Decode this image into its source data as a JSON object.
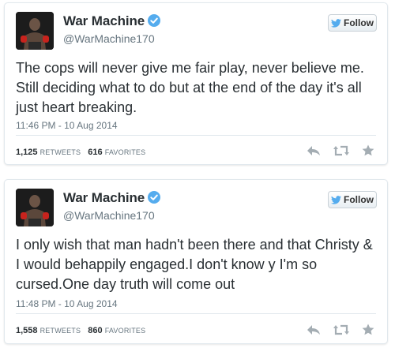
{
  "colors": {
    "verified": "#55acee",
    "text": "#292f33",
    "muted": "#66757f",
    "action_icon": "#a4adb3"
  },
  "tweets": [
    {
      "author": {
        "name": "War Machine",
        "handle": "@WarMachine170",
        "verified": true
      },
      "follow_label": "Follow",
      "text": "The cops will never give me fair play, never believe me. Still deciding what to do but at the end of the day it's all just heart breaking.",
      "timestamp": "11:46 PM - 10 Aug 2014",
      "retweets": "1,125",
      "retweets_label": "RETWEETS",
      "favorites": "616",
      "favorites_label": "FAVORITES",
      "actions": [
        "reply-icon",
        "retweet-icon",
        "favorite-icon"
      ]
    },
    {
      "author": {
        "name": "War Machine",
        "handle": "@WarMachine170",
        "verified": true
      },
      "follow_label": "Follow",
      "text": "I only wish that man hadn't been there and that Christy & I would behappily engaged.I don't know y I'm so cursed.One day truth will come out",
      "timestamp": "11:48 PM - 10 Aug 2014",
      "retweets": "1,558",
      "retweets_label": "RETWEETS",
      "favorites": "860",
      "favorites_label": "FAVORITES",
      "actions": [
        "reply-icon",
        "retweet-icon",
        "favorite-icon"
      ]
    }
  ]
}
